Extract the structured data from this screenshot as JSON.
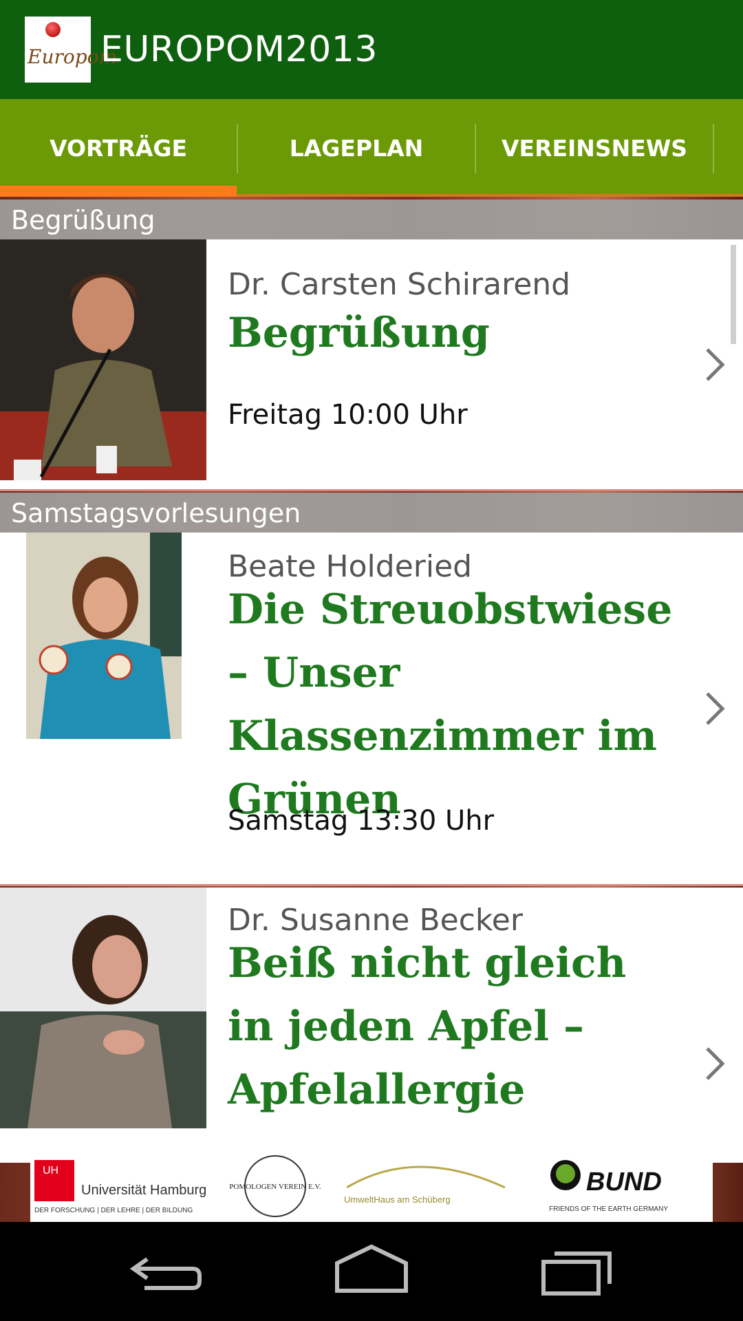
{
  "app": {
    "title": "EUROPOM2013",
    "logo_text": "Europom"
  },
  "tabs": [
    {
      "label": "VORTRÄGE",
      "selected": true
    },
    {
      "label": "LAGEPLAN",
      "selected": false
    },
    {
      "label": "VEREINSNEWS",
      "selected": false
    }
  ],
  "sections": [
    {
      "header": "Begrüßung",
      "items": [
        {
          "speaker": "Dr. Carsten Schirarend",
          "title": "Begrüßung",
          "time": "Freitag 10:00 Uhr"
        }
      ]
    },
    {
      "header": "Samstagsvorlesungen",
      "items": [
        {
          "speaker": "Beate Holderied",
          "title": "Die Streuobstwiese – Unser Klassenzimmer im Grünen",
          "time": "Samstag 13:30 Uhr"
        },
        {
          "speaker": "Dr. Susanne Becker",
          "title": "Beiß nicht gleich in jeden Apfel – Apfelallergie",
          "time": ""
        }
      ]
    }
  ],
  "sponsors": {
    "uhh_name": "Universität Hamburg",
    "uhh_tagline": "DER FORSCHUNG | DER LEHRE | DER BILDUNG",
    "uhh_mark": "UH",
    "pomologen": "POMOLOGEN VEREIN E.V.",
    "umwelthaus": "UmweltHaus am Schüberg",
    "bund": "BUND",
    "bund_tagline": "FRIENDS OF THE EARTH GERMANY"
  },
  "colors": {
    "appbar": "#0e5f0e",
    "tabbar": "#6c9a06",
    "accent": "#ff7a1a",
    "title_green": "#1f7a1f"
  },
  "icons": {
    "row_chevron": "chevron-right-icon",
    "nav_back": "back-icon",
    "nav_home": "home-icon",
    "nav_recent": "recent-apps-icon"
  }
}
